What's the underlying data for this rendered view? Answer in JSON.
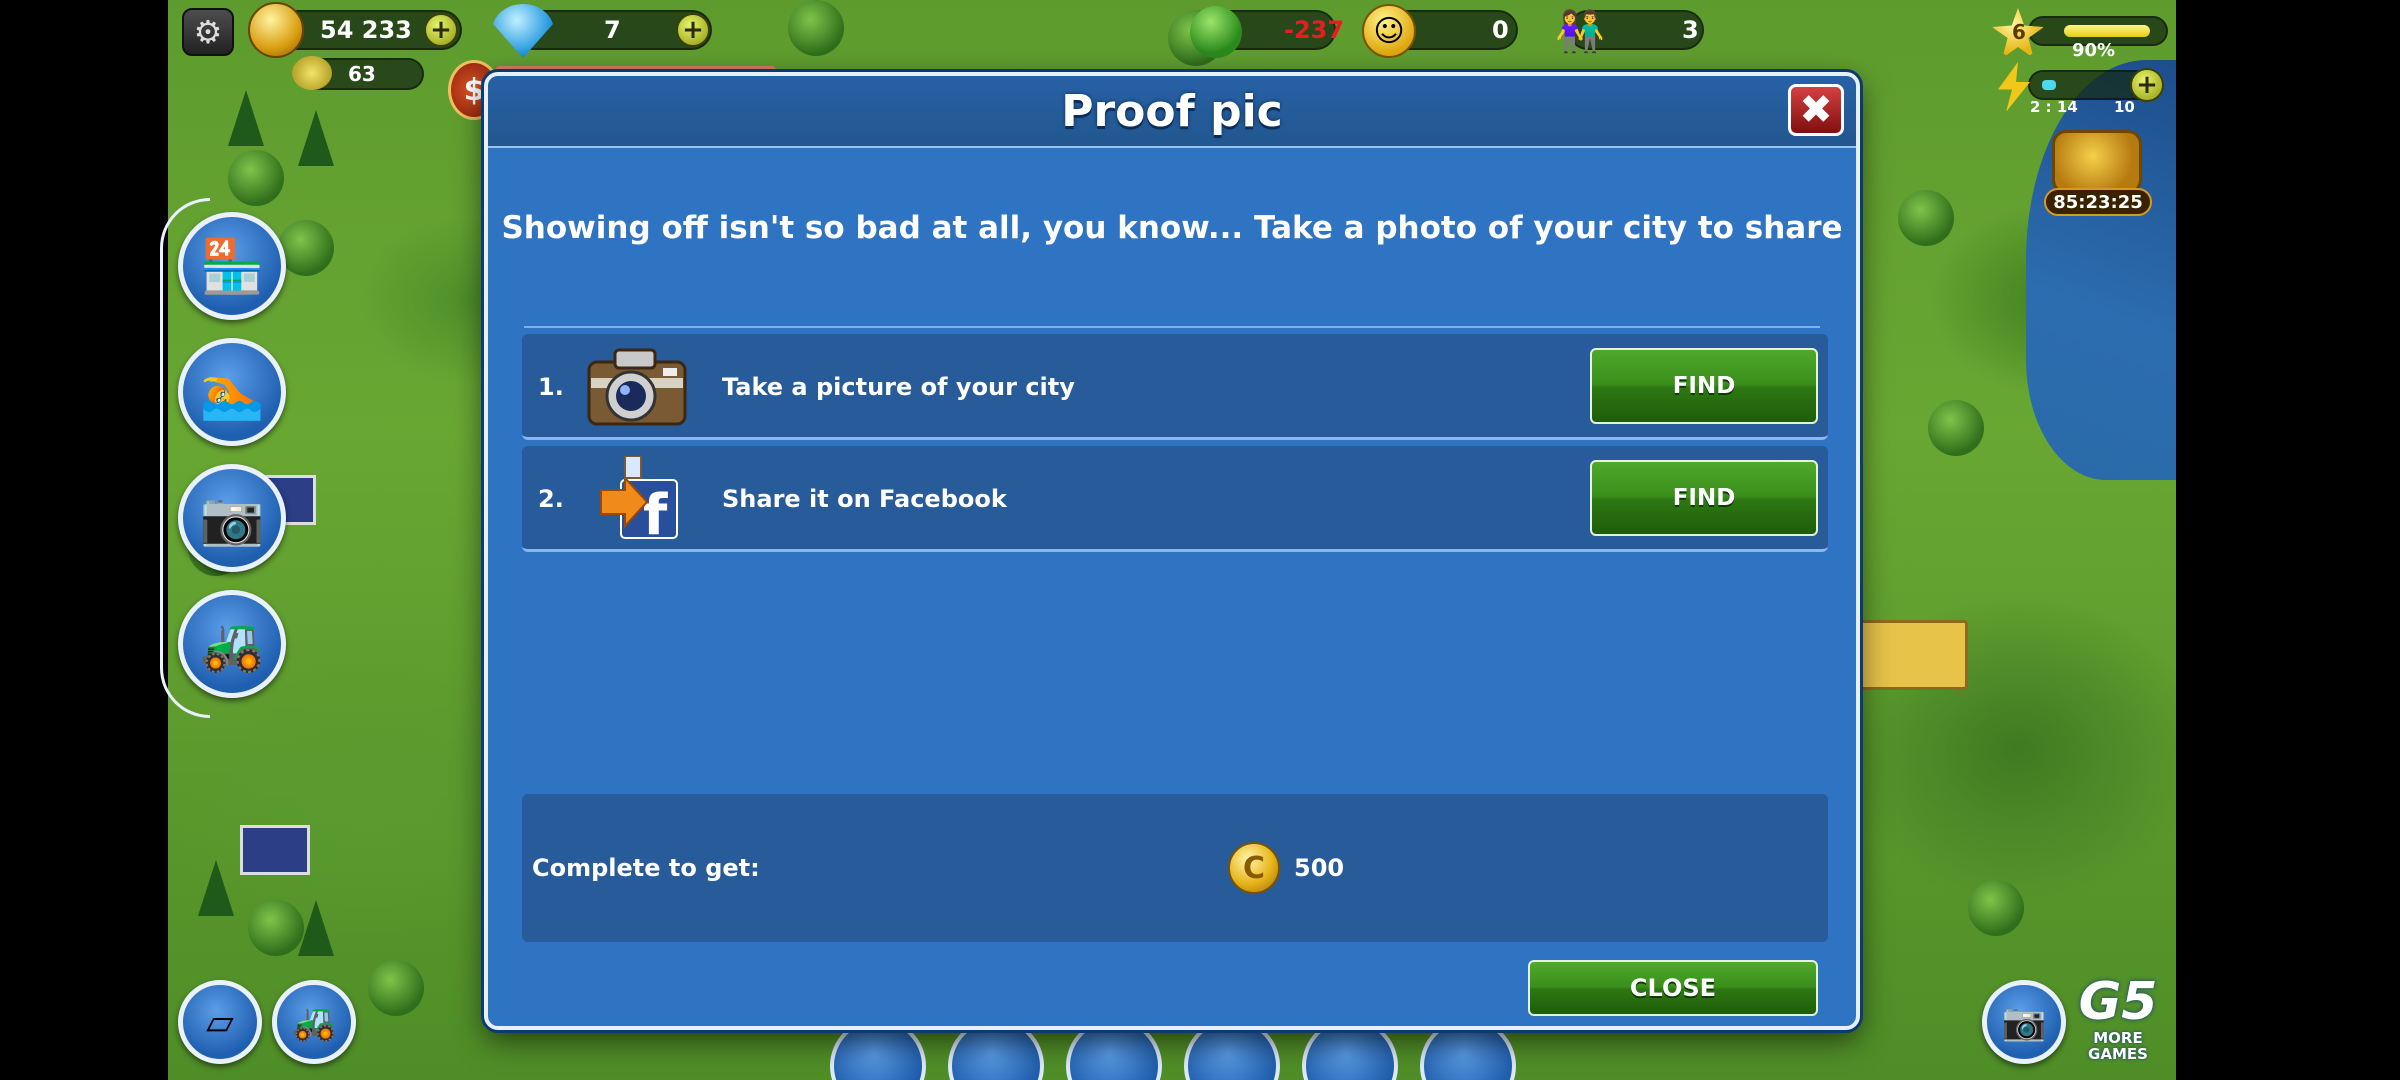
{
  "hud": {
    "coins": "54 233",
    "gems": "7",
    "green_points": "63",
    "ecology": "-237",
    "happiness": "0",
    "population": "3",
    "level": "6",
    "xp_percent": "90%",
    "xp_fraction": 0.9,
    "energy_timer": "2 : 14",
    "energy_value": "10",
    "chest_timer": "85:23:25"
  },
  "dialog": {
    "title": "Proof pic",
    "description": "Showing off isn't so bad at all, you know... Take a photo of your city to share",
    "tasks": [
      {
        "number": "1.",
        "text": "Take a picture of your city",
        "button": "FIND",
        "icon": "camera-icon"
      },
      {
        "number": "2.",
        "text": "Share it on Facebook",
        "button": "FIND",
        "icon": "facebook-share-icon"
      }
    ],
    "reward_label": "Complete to get:",
    "reward_value": "500",
    "reward_coin_symbol": "C",
    "close_button": "CLOSE"
  },
  "branding": {
    "logo_text": "G5",
    "more_games": "MORE GAMES"
  },
  "colors": {
    "dialog_bg": "#2f73c3",
    "button_green": "#3a8e1c",
    "coin_gold": "#e6b41a"
  }
}
